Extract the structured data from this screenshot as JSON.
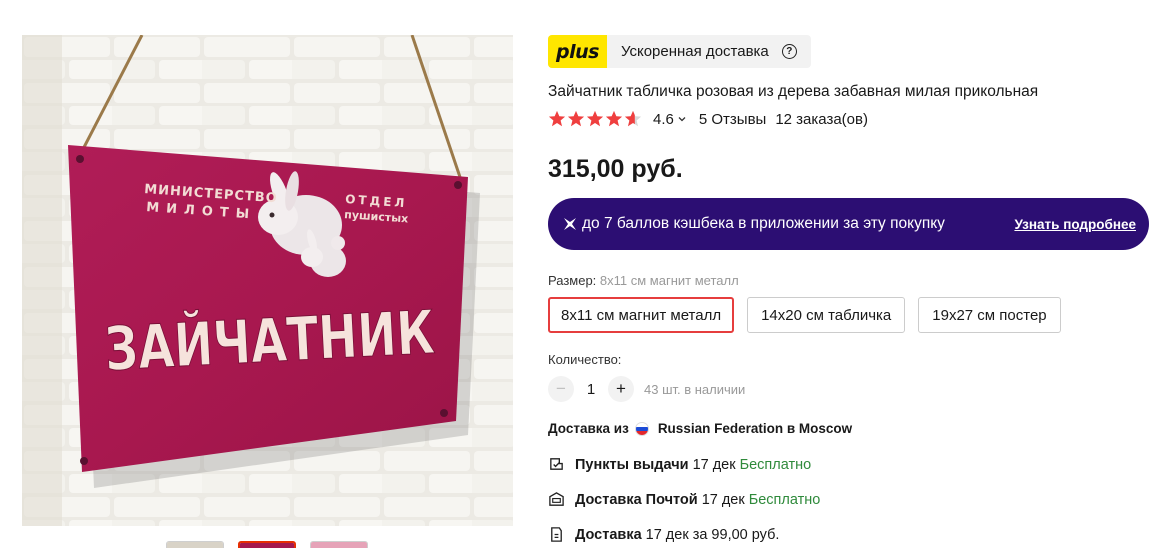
{
  "gallery": {
    "sign": {
      "ministry_line1": "МИНИСТЕРСТВО",
      "ministry_line2": "МИЛОТЫ",
      "dept_line1": "ОТДЕЛ",
      "dept_line2": "пушистых",
      "main_word": "ЗАЙЧАТНИК"
    },
    "thumbnails": [
      {
        "color": "#d9d3c7"
      },
      {
        "color": "#a5184e"
      },
      {
        "color": "#e6a3b8"
      }
    ]
  },
  "badge": {
    "logo": "plus",
    "text": "Ускоренная доставка",
    "help_glyph": "?"
  },
  "product": {
    "title": "Зайчатник табличка розовая из дерева забавная милая прикольная",
    "rating": "4.6",
    "rating_fraction": 0.92,
    "reviews": "5 Отзывы",
    "orders": "12 заказа(ов)",
    "price": "315,00 руб."
  },
  "cashback": {
    "text": "до 7 баллов кэшбека в приложении за эту покупку",
    "link": "Узнать подробнее",
    "bg_color": "#2c0e73"
  },
  "size": {
    "label": "Размер:",
    "selected": "8x11 см магнит металл",
    "options": [
      "8x11 см магнит металл",
      "14x20 см табличка",
      "19x27 см постер"
    ]
  },
  "quantity": {
    "label": "Количество:",
    "minus": "−",
    "value": "1",
    "plus": "+",
    "stock": "43 шт. в наличии"
  },
  "delivery": {
    "from_prefix": "Доставка из",
    "from_place": "Russian Federation в Moscow",
    "items": [
      {
        "name": "Пункты выдачи",
        "date": "17 дек",
        "price": "Бесплатно",
        "icon": "pickup-icon"
      },
      {
        "name": "Доставка Почтой",
        "date": "17 дек",
        "price": "Бесплатно",
        "icon": "mail-icon"
      },
      {
        "name": "Доставка",
        "date": "17 дек за 99,00 руб.",
        "price": "",
        "icon": "courier-icon"
      }
    ],
    "free_color": "#2f8a3b"
  },
  "colors": {
    "accent_red": "#e63d3d",
    "star": "#ef3f3f",
    "plus_yellow": "#ffe600"
  }
}
